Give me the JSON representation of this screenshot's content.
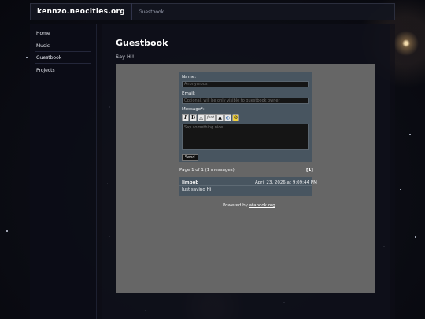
{
  "header": {
    "site_title": "kennzo.neocities.org",
    "breadcrumb": "Guestbook"
  },
  "sidebar": {
    "items": [
      {
        "label": "Home"
      },
      {
        "label": "Music"
      },
      {
        "label": "Guestbook"
      },
      {
        "label": "Projects"
      }
    ]
  },
  "main": {
    "title": "Guestbook",
    "intro": "Say Hi!"
  },
  "form": {
    "name_label": "Name:",
    "name_placeholder": "Anonymous",
    "email_label": "Email:",
    "email_placeholder": "Optional, will be only visible to guestbook owner",
    "message_label": "Message*:",
    "message_placeholder": "Say something nice...",
    "send_label": "Send",
    "toolbar": [
      {
        "icon": "italic-icon",
        "glyph": "I"
      },
      {
        "icon": "bold-icon",
        "glyph": "B"
      },
      {
        "icon": "triangle-icon",
        "glyph": "△"
      },
      {
        "icon": "font-icon",
        "glyph": "font"
      },
      {
        "icon": "image-icon",
        "glyph": "▲"
      },
      {
        "icon": "link-icon",
        "glyph": "◐"
      },
      {
        "icon": "emoji-icon",
        "glyph": "☺"
      }
    ]
  },
  "pagination": {
    "summary": "Page 1 of 1 (1 messages)",
    "page_link": "[1]"
  },
  "entries": [
    {
      "name": "Jimbob",
      "date": "April 23, 2026 at 9:09:44 PM",
      "text": "Just saying Hi"
    }
  ],
  "footer": {
    "powered_prefix": "Powered by",
    "powered_link": "atabook.org"
  }
}
